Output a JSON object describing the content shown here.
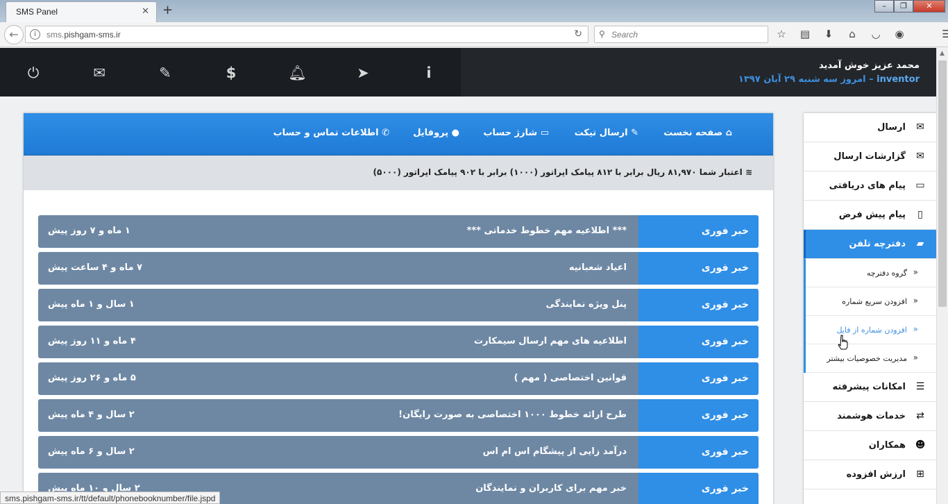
{
  "browser": {
    "tab_title": "SMS Panel",
    "url_prefix": "sms.",
    "url_domain": "pishgam-sms.ir",
    "search_placeholder": "Search",
    "status_url": "sms.pishgam-sms.ir/tt/default/phonebooknumber/file.jspd"
  },
  "header": {
    "welcome": "محمد عزیز خوش آمدید",
    "username": "inventor",
    "date_text": "– امروز سه شنبه ۲۹ آبان ۱۳۹۷",
    "icons": [
      "power-icon",
      "envelope-icon",
      "ticket-icon",
      "dollar-icon",
      "bell-icon",
      "paper-plane-icon",
      "info-icon"
    ]
  },
  "topmenu": [
    {
      "label": "صفحه نخست",
      "icon": "home-icon"
    },
    {
      "label": "ارسال تیکت",
      "icon": "ticket-icon"
    },
    {
      "label": "شارژ حساب",
      "icon": "credit-card-icon"
    },
    {
      "label": "پروفایل",
      "icon": "user-icon"
    },
    {
      "label": "اطلاعات تماس و حساب",
      "icon": "phone-icon"
    }
  ],
  "credit_text": "اعتبار شما ۸۱,۹۷۰ ریال برابر با ۸۱۲ پیامک اپراتور (۱۰۰۰) برابر با ۹۰۲ پیامک اپراتور (۵۰۰۰)",
  "news": [
    {
      "tag": "خبر فوری",
      "title": "*** اطلاعیه مهم خطوط خدماتی ***",
      "time": "۱ ماه و ۷ روز پیش"
    },
    {
      "tag": "خبر فوری",
      "title": "اعیاد شعبانیه",
      "time": "۷ ماه و ۴ ساعت پیش"
    },
    {
      "tag": "خبر فوری",
      "title": "پنل ویژه نمایندگی",
      "time": "۱ سال و ۱ ماه پیش"
    },
    {
      "tag": "خبر فوری",
      "title": "اطلاعیه های مهم ارسال سیمکارت",
      "time": "۴ ماه و ۱۱ روز پیش"
    },
    {
      "tag": "خبر فوری",
      "title": "قوانین اختصاصی ( مهم )",
      "time": "۵ ماه و ۲۶ روز پیش"
    },
    {
      "tag": "خبر فوری",
      "title": "طرح ارائه خطوط ۱۰۰۰ اختصاصی به صورت رایگان!",
      "time": "۲ سال و ۴ ماه پیش"
    },
    {
      "tag": "خبر فوری",
      "title": "درآمد زایی از پیشگام اس ام اس",
      "time": "۲ سال و ۶ ماه پیش"
    },
    {
      "tag": "خبر فوری",
      "title": "خبر مهم برای کاربران و نمایندگان",
      "time": "۲ سال و ۱۰ ماه پیش"
    }
  ],
  "sidebar": {
    "items": [
      {
        "label": "ارسال",
        "icon": "envelope-icon"
      },
      {
        "label": "گزارشات ارسال",
        "icon": "envelope-outline-icon"
      },
      {
        "label": "پیام های دریافتی",
        "icon": "inbox-icon"
      },
      {
        "label": "پیام پیش فرض",
        "icon": "tablet-icon"
      },
      {
        "label": "دفترچه تلفن",
        "icon": "book-icon"
      }
    ],
    "subitems": [
      {
        "label": "گروه دفترچه"
      },
      {
        "label": "افزودن سریع شماره"
      },
      {
        "label": "افزودن شماره از فایل"
      },
      {
        "label": "مدیریت خصوصیات بیشتر"
      }
    ],
    "items2": [
      {
        "label": "امکانات پیشرفته",
        "icon": "list-icon"
      },
      {
        "label": "خدمات هوشمند",
        "icon": "retweet-icon"
      },
      {
        "label": "همکاران",
        "icon": "users-icon"
      },
      {
        "label": "ارزش افزوده",
        "icon": "plus-square-icon"
      }
    ]
  },
  "colors": {
    "accent": "#2f8ee6",
    "news_row": "#6e88a4",
    "header_bg": "#1a1d22"
  }
}
